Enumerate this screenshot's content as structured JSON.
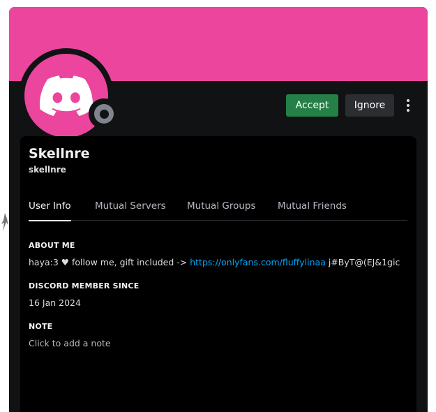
{
  "profile": {
    "display_name": "Skellnre",
    "username": "skellnre",
    "status": "offline",
    "colors": {
      "banner": "#eb459e",
      "avatar": "#eb459e",
      "accept": "#248046",
      "ignore": "#2b2d31",
      "link": "#00a8fc"
    },
    "avatar_icon": "discord-logo-icon",
    "status_icon": "offline-status-icon"
  },
  "actions": {
    "accept_label": "Accept",
    "ignore_label": "Ignore",
    "more_icon": "more-vertical-icon"
  },
  "tabs": [
    {
      "label": "User Info",
      "active": true
    },
    {
      "label": "Mutual Servers",
      "active": false
    },
    {
      "label": "Mutual Groups",
      "active": false
    },
    {
      "label": "Mutual Friends",
      "active": false
    }
  ],
  "about": {
    "title": "ABOUT ME",
    "text_before": "haya:3 ♥ follow me, gift included -> ",
    "link": "https://onlyfans.com/fluffylinaa",
    "text_after": " j#ByT@(EJ&1gic"
  },
  "member_since": {
    "title": "DISCORD MEMBER SINCE",
    "value": "16 Jan 2024"
  },
  "note": {
    "title": "NOTE",
    "placeholder": "Click to add a note"
  }
}
